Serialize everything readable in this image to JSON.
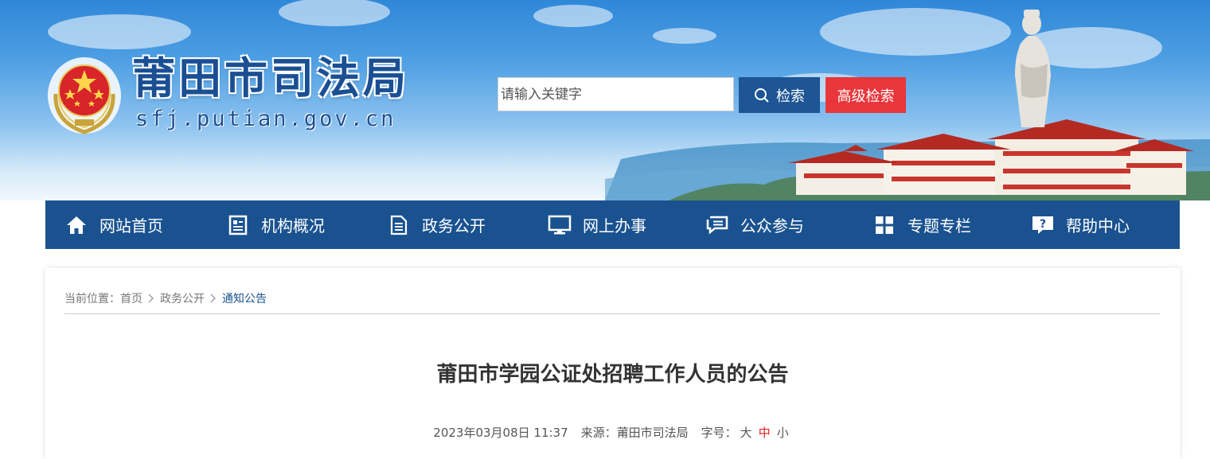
{
  "header": {
    "site_title": "莆田市司法局",
    "site_domain": "sfj.putian.gov.cn"
  },
  "search": {
    "placeholder": "请输入关键字",
    "search_label": "检索",
    "advanced_label": "高级检索"
  },
  "nav": {
    "items": [
      {
        "label": "网站首页",
        "icon": "home-icon"
      },
      {
        "label": "机构概况",
        "icon": "document-list-icon"
      },
      {
        "label": "政务公开",
        "icon": "file-icon"
      },
      {
        "label": "网上办事",
        "icon": "monitor-icon"
      },
      {
        "label": "公众参与",
        "icon": "chat-icon"
      },
      {
        "label": "专题专栏",
        "icon": "grid-icon"
      },
      {
        "label": "帮助中心",
        "icon": "help-icon"
      }
    ]
  },
  "breadcrumb": {
    "prefix": "当前位置：",
    "items": [
      "首页",
      "政务公开",
      "通知公告"
    ]
  },
  "article": {
    "title": "莆田市学园公证处招聘工作人员的公告",
    "date": "2023年03月08日 11:37",
    "source_label": "来源：",
    "source": "莆田市司法局",
    "font_size_label": "字号：",
    "font_sizes": [
      "大",
      "中",
      "小"
    ]
  },
  "colors": {
    "nav_bg": "#1a5290",
    "search_btn": "#1d5595",
    "advanced_btn": "#e8363b",
    "active_size": "#e02020"
  }
}
